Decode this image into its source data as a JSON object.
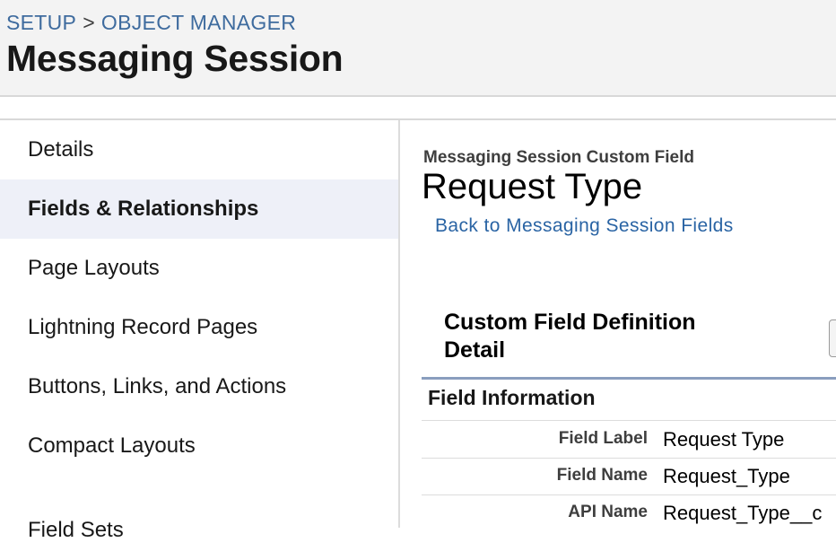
{
  "breadcrumb": {
    "setup": "SETUP",
    "separator": ">",
    "object_manager": "OBJECT MANAGER"
  },
  "page_title": "Messaging Session",
  "sidebar": {
    "items": [
      {
        "label": "Details",
        "active": false
      },
      {
        "label": "Fields & Relationships",
        "active": true
      },
      {
        "label": "Page Layouts",
        "active": false
      },
      {
        "label": "Lightning Record Pages",
        "active": false
      },
      {
        "label": "Buttons, Links, and Actions",
        "active": false
      },
      {
        "label": "Compact Layouts",
        "active": false
      },
      {
        "label": "Field Sets",
        "active": false
      }
    ]
  },
  "main": {
    "object_subtitle": "Messaging Session Custom Field",
    "field_title": "Request Type",
    "back_link": "Back to Messaging Session Fields",
    "detail_heading": "Custom Field Definition Detail",
    "section_heading": "Field Information",
    "fields": [
      {
        "label": "Field Label",
        "value": "Request Type"
      },
      {
        "label": "Field Name",
        "value": "Request_Type"
      },
      {
        "label": "API Name",
        "value": "Request_Type__c"
      }
    ]
  },
  "colors": {
    "link": "#2a64a4",
    "breadcrumb": "#3e6b9e",
    "active_nav_bg": "#eef0f8",
    "rule": "#8a9ebe"
  }
}
